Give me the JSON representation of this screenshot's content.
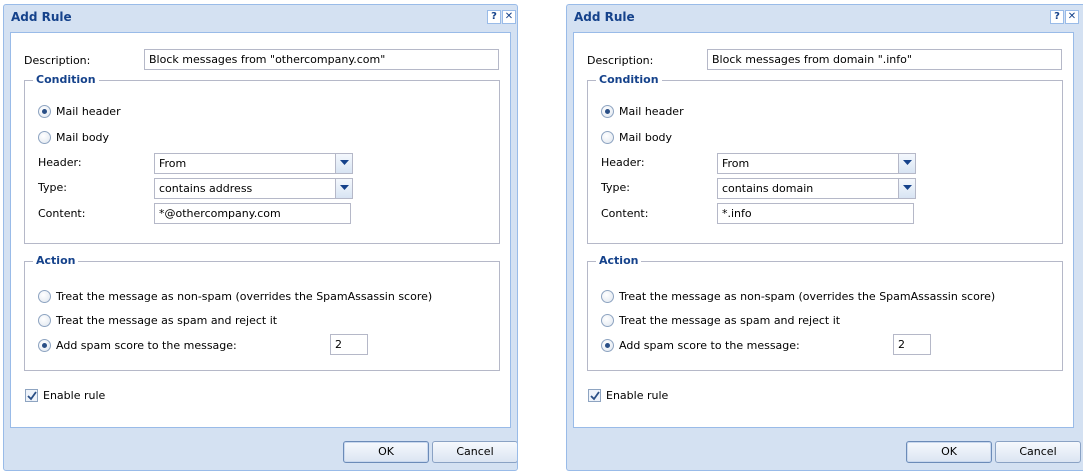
{
  "dialogs": [
    {
      "title": "Add Rule",
      "help_icon": "question-mark",
      "close_icon": "x",
      "description_label": "Description:",
      "description_value": "Block messages from \"othercompany.com\"",
      "condition": {
        "legend": "Condition",
        "radio_header": "Mail header",
        "radio_body": "Mail body",
        "selected": "Mail header",
        "header_label": "Header:",
        "header_value": "From",
        "type_label": "Type:",
        "type_value": "contains address",
        "content_label": "Content:",
        "content_value": "*@othercompany.com"
      },
      "action": {
        "legend": "Action",
        "option1": "Treat the message as non-spam (overrides the SpamAssassin score)",
        "option2": "Treat the message as spam and reject it",
        "option3": "Add spam score to the message:",
        "selected": "option3",
        "score_value": "2"
      },
      "enable_rule_label": "Enable rule",
      "enable_rule_checked": true,
      "ok_label": "OK",
      "cancel_label": "Cancel"
    },
    {
      "title": "Add Rule",
      "help_icon": "question-mark",
      "close_icon": "x",
      "description_label": "Description:",
      "description_value": "Block messages from domain \".info\"",
      "condition": {
        "legend": "Condition",
        "radio_header": "Mail header",
        "radio_body": "Mail body",
        "selected": "Mail header",
        "header_label": "Header:",
        "header_value": "From",
        "type_label": "Type:",
        "type_value": "contains domain",
        "content_label": "Content:",
        "content_value": "*.info"
      },
      "action": {
        "legend": "Action",
        "option1": "Treat the message as non-spam (overrides the SpamAssassin score)",
        "option2": "Treat the message as spam and reject it",
        "option3": "Add spam score to the message:",
        "selected": "option3",
        "score_value": "2"
      },
      "enable_rule_label": "Enable rule",
      "enable_rule_checked": true,
      "ok_label": "OK",
      "cancel_label": "Cancel"
    }
  ],
  "colors": {
    "dialog_bg": "#d4e1f2",
    "title_text": "#15428b",
    "border": "#99bbe8"
  }
}
